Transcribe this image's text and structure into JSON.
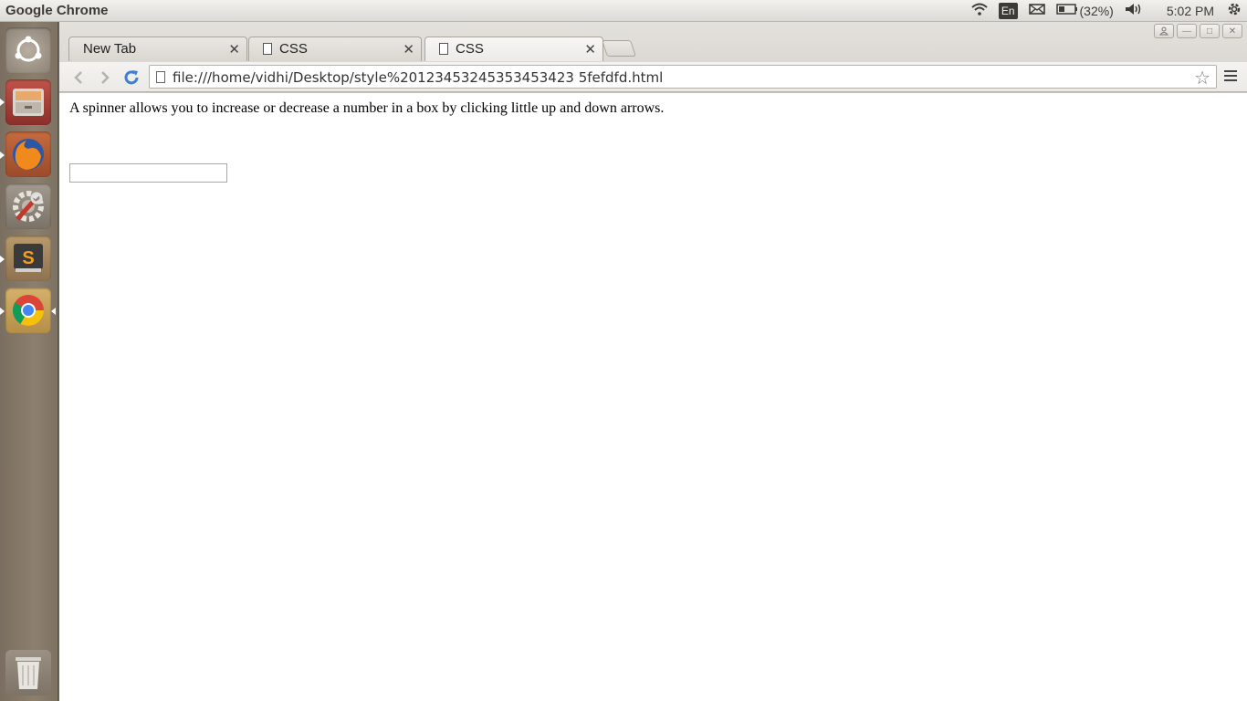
{
  "top_panel": {
    "app_title": "Google Chrome",
    "keyboard_layout": "En",
    "battery": "(32%)",
    "time": "5:02 PM"
  },
  "launcher": {
    "items": [
      "ubuntu-dash",
      "files",
      "firefox",
      "system-settings",
      "sublime-text",
      "chrome"
    ],
    "trash": "trash"
  },
  "browser": {
    "tabs": [
      {
        "label": "New Tab",
        "active": false
      },
      {
        "label": "CSS",
        "active": false
      },
      {
        "label": "CSS",
        "active": true
      }
    ],
    "address": "file:///home/vidhi/Desktop/style%20123453245353453423 5fefdfd.html"
  },
  "page": {
    "paragraph": "A spinner allows you to increase or decrease a number in a box by clicking little up and down arrows.",
    "spinner_value": ""
  },
  "colors": {
    "panel_bg": "#dcdad5",
    "launcher_bg": "#8c7f6e",
    "text": "#3c3b37"
  }
}
